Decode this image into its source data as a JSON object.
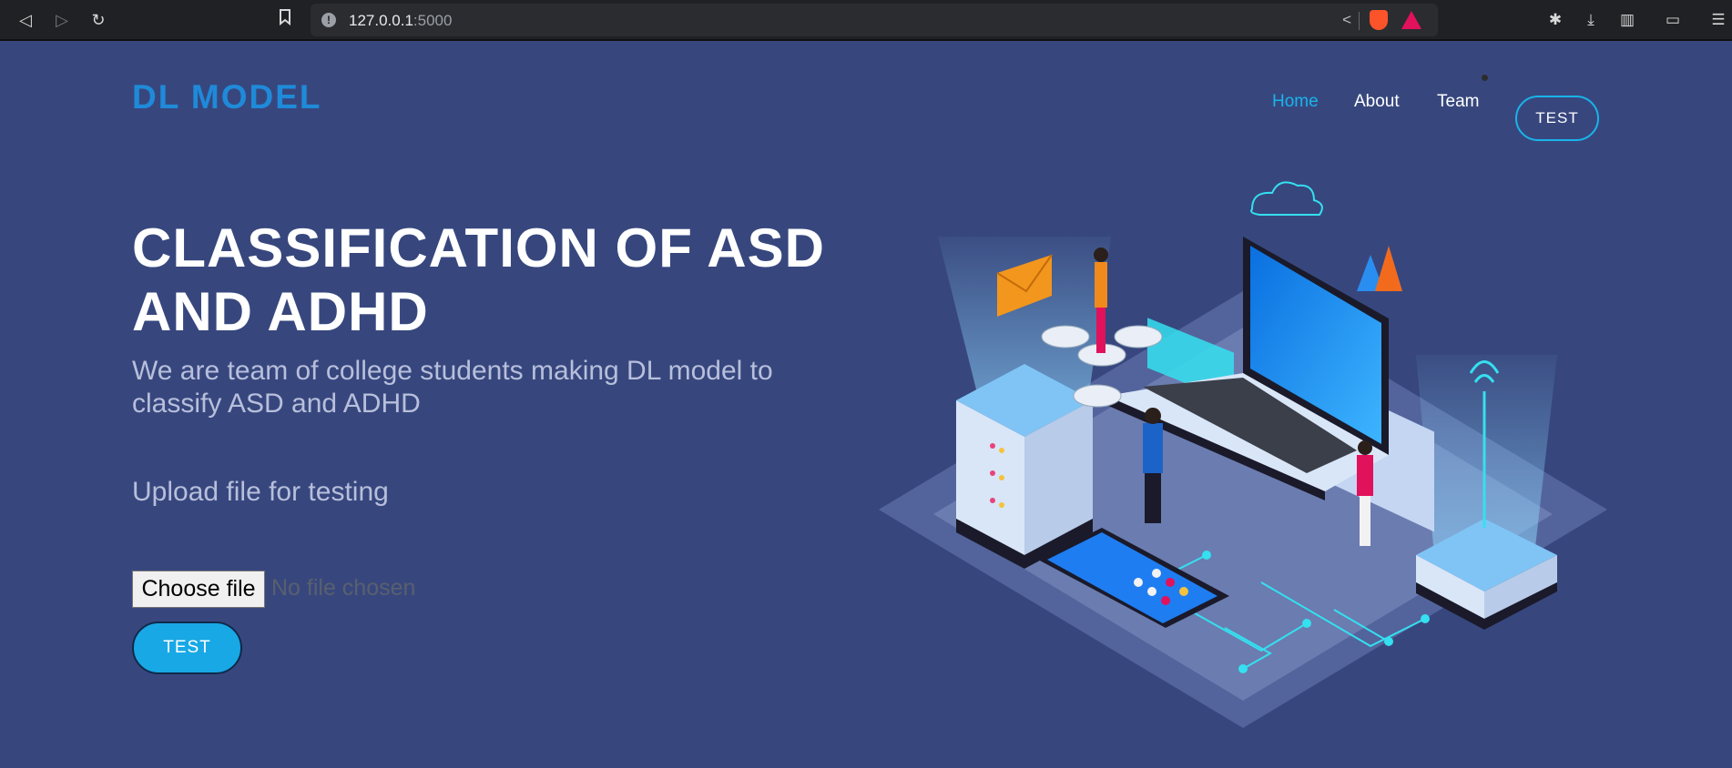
{
  "browser": {
    "url_host": "127.0.0.1",
    "url_port": ":5000"
  },
  "site": {
    "logo": "DL MODEL",
    "nav": [
      "Home",
      "About",
      "Team"
    ],
    "nav_test_button": "TEST"
  },
  "hero": {
    "title": "CLASSIFICATION OF ASD AND ADHD",
    "subtitle": "We are team of college students making DL model to classify ASD and ADHD",
    "upload_label": "Upload file for testing",
    "file_button": "Choose file",
    "file_status": "No file chosen",
    "test_button": "TEST"
  },
  "colors": {
    "background": "#37477e",
    "accent": "#19b4ea",
    "logo": "#1f8ad9"
  }
}
